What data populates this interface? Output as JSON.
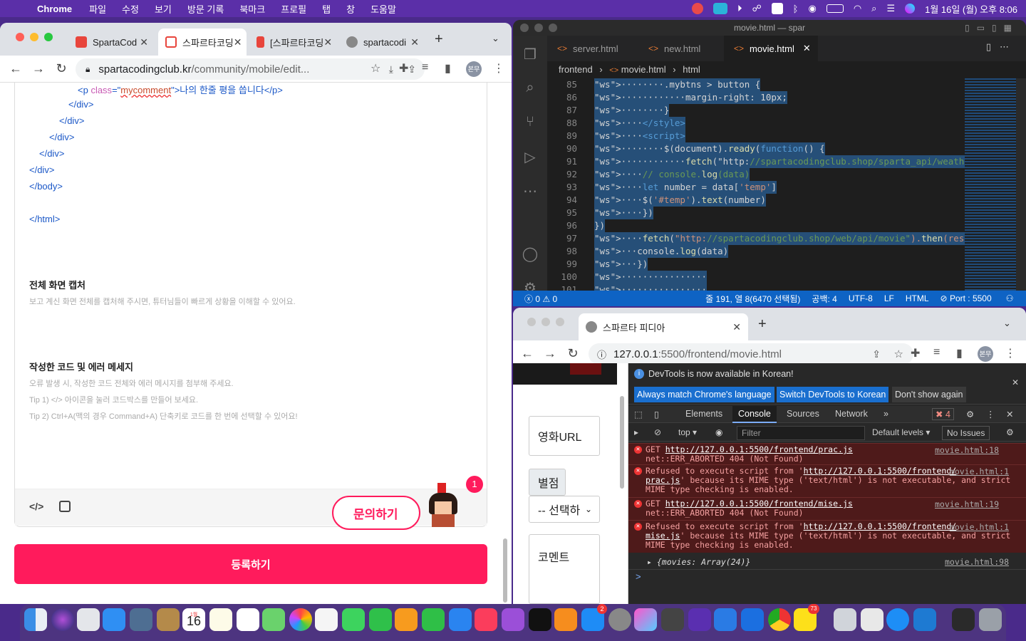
{
  "menubar": {
    "apple": "",
    "app_name": "Chrome",
    "items": [
      "파일",
      "수정",
      "보기",
      "방문 기록",
      "북마크",
      "프로필",
      "탭",
      "창",
      "도움말"
    ],
    "clock": "1월 16일 (월) 오후 8:06"
  },
  "left_browser": {
    "tabs": [
      {
        "label": "SpartaCod",
        "icon": "sparta-favicon",
        "color": "#e8453c"
      },
      {
        "label": "스파르타코딩",
        "icon": "code-favicon",
        "color": "#e8453c"
      },
      {
        "label": "[스파르타코딩",
        "icon": "book-favicon",
        "color": "#e8453c"
      },
      {
        "label": "spartacodi",
        "icon": "globe-icon",
        "color": "#777777"
      }
    ],
    "url_host": "spartacodingclub.kr",
    "url_path": "/community/mobile/edit...",
    "avatar": "본무",
    "code_lines": [
      {
        "open": "<p ",
        "attr": "class",
        "eq": "=\"",
        "val": "mycomment",
        "close": "\">나의 한줄 평을 씁니다</p>"
      },
      {
        "text": "</div>"
      },
      {
        "text": "</div>"
      },
      {
        "text": "</div>"
      },
      {
        "text": "</div>"
      },
      {
        "text": "</div>"
      },
      {
        "text": "</body>"
      },
      {
        "text": "</html>"
      }
    ],
    "capture_title": "전체 화면 캡처",
    "capture_desc": "보고 계신 화면 전체를 캡처해 주시면, 튜터님들이 빠르게 상황을 이해할 수 있어요.",
    "code_title": "작성한 코드 및 에러 메세지",
    "code_desc1": "오류 발생 시, 작성한 코드 전체와 에러 메시지를 첨부해 주세요.",
    "code_desc2": "Tip 1) </> 아이콘을 눌러 코드박스를 만들어 보세요.",
    "code_desc3": "Tip 2) Ctrl+A(맥의 경우 Command+A) 단축키로 코드를 한 번에 선택할 수 있어요!",
    "inquiry_label": "문의하기",
    "inquiry_badge": "1",
    "register_label": "등록하기"
  },
  "vscode": {
    "title": "movie.html — spar",
    "tabs": [
      "server.html",
      "new.html",
      "movie.html"
    ],
    "breadcrumb": [
      "frontend",
      "movie.html",
      "html"
    ],
    "lines": [
      {
        "n": "85",
        "code": "        .mybtns > button {"
      },
      {
        "n": "86",
        "code": "            margin-right: 10px;"
      },
      {
        "n": "87",
        "code": "        }"
      },
      {
        "n": "88",
        "code": "    </style>"
      },
      {
        "n": "89",
        "code": "    <script>"
      },
      {
        "n": "90",
        "code": "        $(document).ready(function() {"
      },
      {
        "n": "91",
        "code": "            fetch(\"http://spartacodingclub.shop/sparta_api/weather/seou"
      },
      {
        "n": "92",
        "code": "    // console.log(data)"
      },
      {
        "n": "93",
        "code": "    let number = data['temp']"
      },
      {
        "n": "94",
        "code": "    $('#temp').text(number)"
      },
      {
        "n": "95",
        "code": "    })"
      },
      {
        "n": "96",
        "code": "})"
      },
      {
        "n": "97",
        "code": "    fetch(\"http://spartacodingclub.shop/web/api/movie\").then(res => res"
      },
      {
        "n": "98",
        "code": "   console.log(data)"
      },
      {
        "n": "99",
        "code": "   })"
      },
      {
        "n": "100",
        "code": "                "
      },
      {
        "n": "101",
        "code": "                "
      }
    ],
    "status": {
      "problems_errors": "0",
      "problems_warnings": "0",
      "cursor": "줄 191, 열 8(6470 선택됨)",
      "spaces": "공백: 4",
      "encoding": "UTF-8",
      "eol": "LF",
      "language": "HTML",
      "port": "Port : 5500"
    }
  },
  "right_browser": {
    "tab_label": "스파르타 피디아",
    "url_host": "127.0.0.1",
    "url_path": ":5500/frontend/movie.html",
    "avatar": "본무",
    "page_fields": {
      "url": "영화URL",
      "star_label": "별점",
      "select": "-- 선택하",
      "comment": "코멘트"
    },
    "devtools": {
      "notice": "DevTools is now available in Korean!",
      "btn_match": "Always match Chrome's language",
      "btn_switch": "Switch DevTools to Korean",
      "btn_dismiss": "Don't show again",
      "tabs": [
        "Elements",
        "Console",
        "Sources",
        "Network"
      ],
      "error_count": "4",
      "context": "top",
      "filter_placeholder": "Filter",
      "levels": "Default levels",
      "issues": "No Issues",
      "messages": [
        {
          "line1a": "GET ",
          "link1": "http://127.0.0.1:5500/frontend/prac.js",
          "line2": "net::ERR_ABORTED 404 (Not Found)",
          "src": "movie.html:18"
        },
        {
          "line1a": "Refused to execute script from '",
          "link1": "http://127.0.0.1:5500/frontend/",
          "link2": "prac.js",
          "line2": "' because its MIME type ('text/html') is not executable, and strict",
          "line3": "MIME type checking is enabled.",
          "src": "movie.html:1"
        },
        {
          "line1a": "GET ",
          "link1": "http://127.0.0.1:5500/frontend/mise.js",
          "line2": "net::ERR_ABORTED 404 (Not Found)",
          "src": "movie.html:19"
        },
        {
          "line1a": "Refused to execute script from '",
          "link1": "http://127.0.0.1:5500/frontend/",
          "link2": "mise.js",
          "line2": "' because its MIME type ('text/html') is not executable, and strict",
          "line3": "MIME type checking is enabled.",
          "src": "movie.html:1"
        }
      ],
      "log": "{movies: Array(24)}",
      "log_src": "movie.html:98",
      "prompt": ">"
    }
  },
  "dock": {
    "calendar_month": "1월",
    "calendar_day": "16",
    "badge_appstore": "2",
    "badge_kakao": "73"
  }
}
